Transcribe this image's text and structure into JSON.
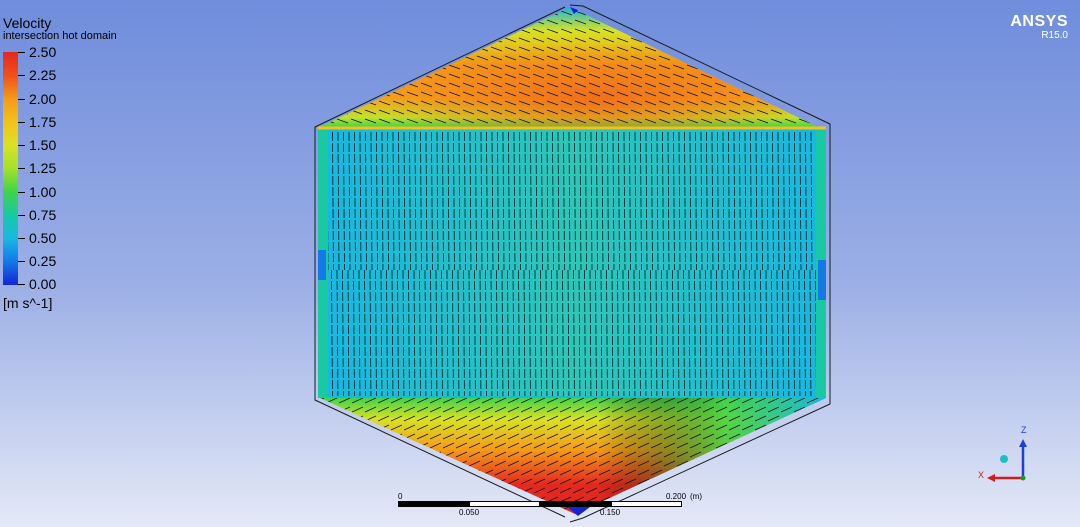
{
  "legend": {
    "title": "Velocity",
    "subtitle": "intersection hot domain",
    "ticks": [
      "2.50",
      "2.25",
      "2.00",
      "1.75",
      "1.50",
      "1.25",
      "1.00",
      "0.75",
      "0.50",
      "0.25",
      "0.00"
    ],
    "unit": "[m s^-1]",
    "colors": [
      "#e3281f",
      "#f0501a",
      "#f49a18",
      "#f2c21b",
      "#d9e222",
      "#a4e02a",
      "#3fd44a",
      "#18c9a4",
      "#18b8e0",
      "#1478e6",
      "#1424d6"
    ]
  },
  "brand": {
    "name": "ANSYS",
    "version": "R15.0"
  },
  "scale_bar": {
    "labels_top": [
      "0",
      "0.200",
      "(m)"
    ],
    "labels_bottom": [
      "0.050",
      "0.150"
    ]
  },
  "triad": {
    "x_label": "X",
    "z_label": "Z",
    "x_color": "#d21c1c",
    "z_color": "#1f3fd6",
    "y_color": "#1cbfbf"
  }
}
